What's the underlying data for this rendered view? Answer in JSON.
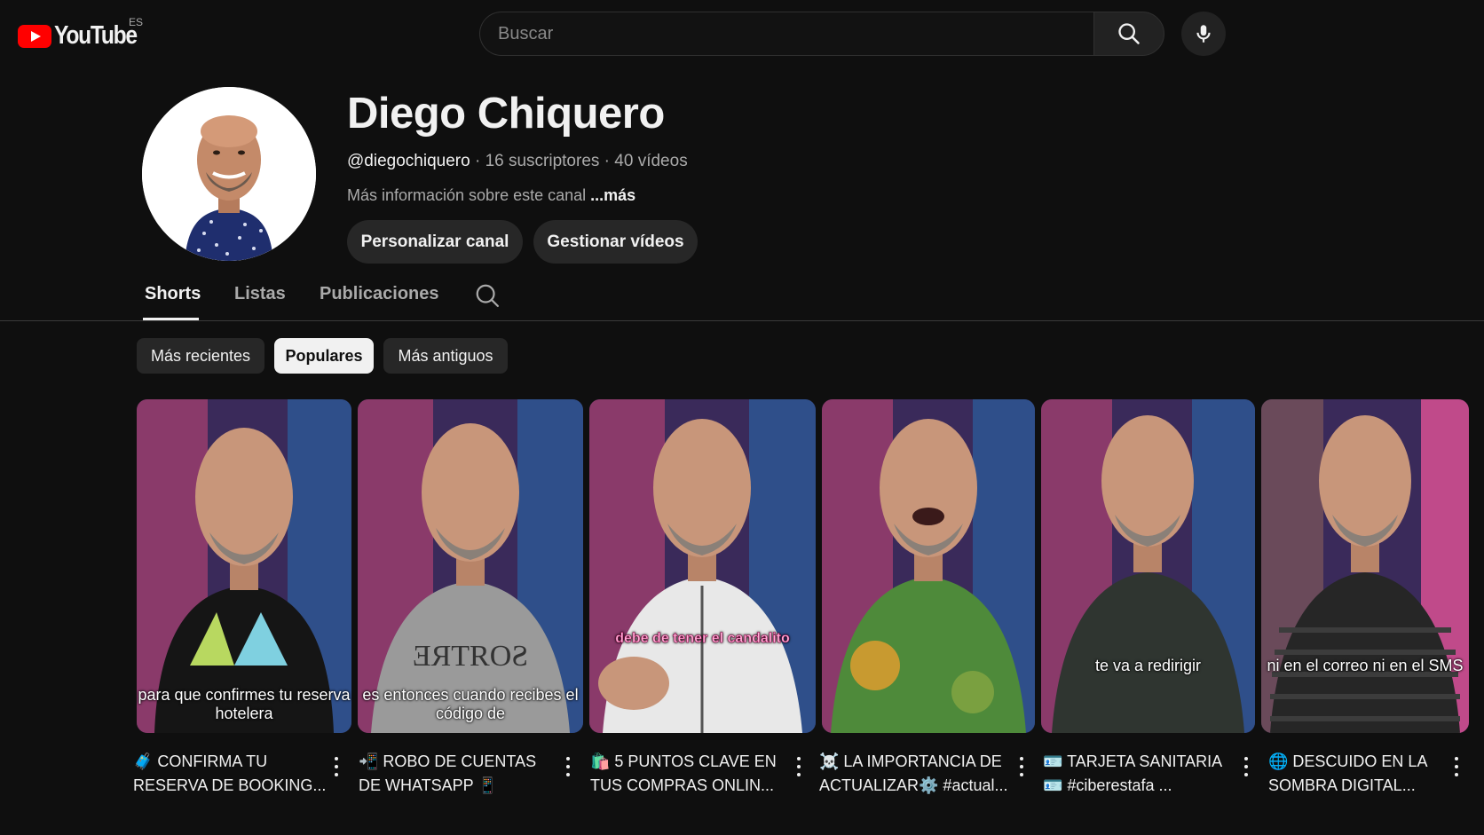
{
  "header": {
    "logo_text": "YouTube",
    "country_code": "ES",
    "search_placeholder": "Buscar",
    "search_icon": "search-icon",
    "mic_icon": "mic-icon"
  },
  "channel": {
    "name": "Diego Chiquero",
    "handle": "@diegochiquero",
    "subscribers": "16 suscriptores",
    "videos": "40 vídeos",
    "separator": " · ",
    "about": "Más información sobre este canal",
    "about_more": "...más",
    "customize_button": "Personalizar canal",
    "manage_button": "Gestionar vídeos"
  },
  "tabs": [
    {
      "label": "Shorts",
      "active": true
    },
    {
      "label": "Listas",
      "active": false
    },
    {
      "label": "Publicaciones",
      "active": false
    }
  ],
  "chips": [
    {
      "label": "Más recientes",
      "active": false
    },
    {
      "label": "Populares",
      "active": true
    },
    {
      "label": "Más antiguos",
      "active": false
    }
  ],
  "shorts": [
    {
      "caption": "para que confirmes tu reserva hotelera",
      "title_line1": "🧳 CONFIRMA TU",
      "title_line2": "RESERVA DE BOOKING..."
    },
    {
      "caption": "es entonces cuando recibes el código de",
      "title_line1": "📲 ROBO DE CUENTAS",
      "title_line2": "DE WHATSAPP 📱"
    },
    {
      "caption": "debe de tener el candalito",
      "title_line1": "🛍️ 5 PUNTOS CLAVE EN",
      "title_line2": "TUS COMPRAS ONLIN..."
    },
    {
      "caption": "",
      "title_line1": "☠️ LA IMPORTANCIA DE",
      "title_line2": "ACTUALIZAR⚙️ #actual..."
    },
    {
      "caption": "te va a redirigir",
      "title_line1": "🪪 TARJETA SANITARIA",
      "title_line2": "🪪 #ciberestafa ..."
    },
    {
      "caption": "ni en el correo ni en el SMS",
      "title_line1": "🌐 DESCUIDO EN LA",
      "title_line2": "SOMBRA DIGITAL..."
    }
  ],
  "colors": {
    "background": "#0f0f0f",
    "brand_red": "#ff0000",
    "chip_bg": "#272727"
  }
}
